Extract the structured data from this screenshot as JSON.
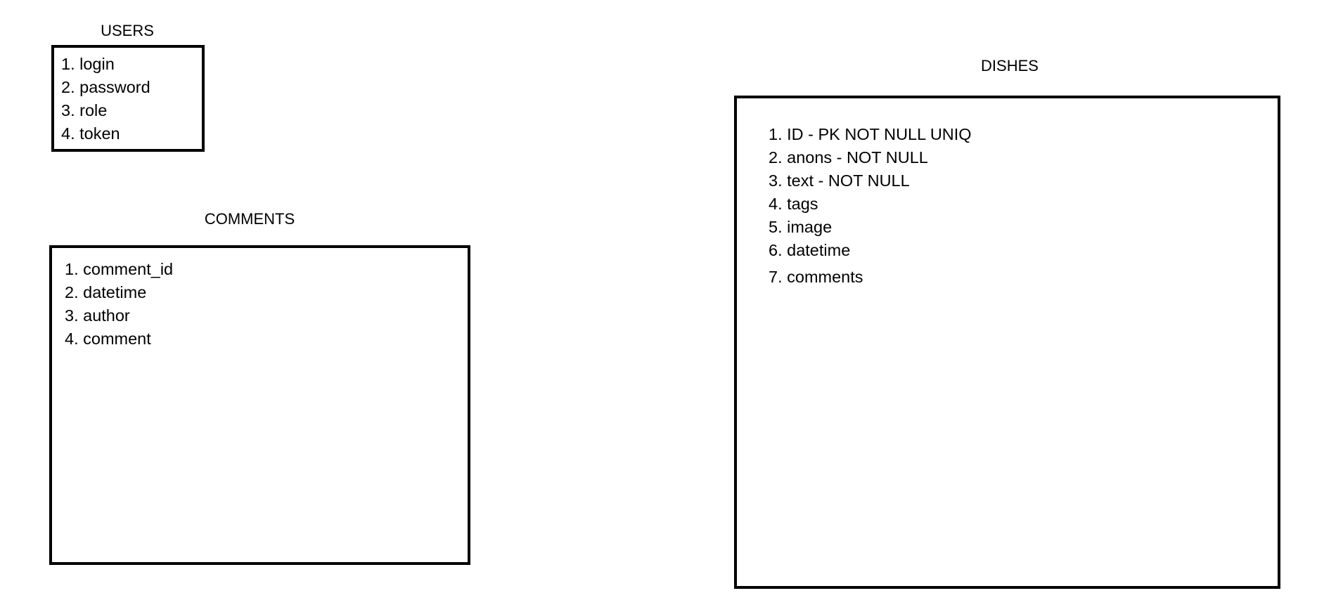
{
  "tables": [
    {
      "name": "USERS",
      "fields": [
        "1. login",
        "2. password",
        "3. role",
        "4. token"
      ]
    },
    {
      "name": "COMMENTS",
      "fields": [
        "1. comment_id",
        "2. datetime",
        "3. author",
        "4. comment"
      ]
    },
    {
      "name": "DISHES",
      "fields": [
        "1. ID - PK NOT NULL UNIQ",
        "2. anons - NOT NULL",
        "3. text - NOT NULL",
        "4. tags",
        "5. image",
        "6. datetime",
        "7. comments"
      ]
    }
  ]
}
